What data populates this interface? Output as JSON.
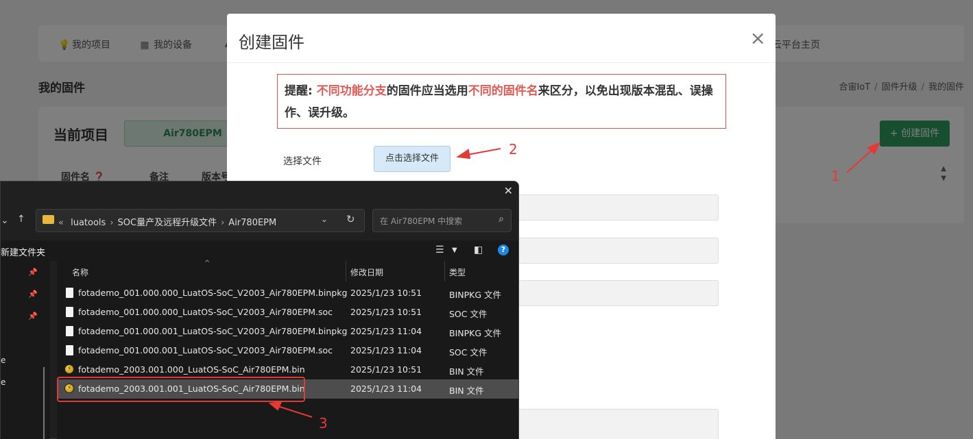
{
  "top_nav": {
    "items": [
      {
        "label": "我的项目",
        "icon": "lightbulb-icon"
      },
      {
        "label": "我的设备",
        "icon": "chip-icon"
      },
      {
        "label": "云平台主页",
        "icon": "home-icon"
      }
    ]
  },
  "page": {
    "title": "我的固件",
    "breadcrumb": [
      "合宙IoT",
      "固件升级",
      "我的固件"
    ]
  },
  "project_card": {
    "current_project_label": "当前项目",
    "project_name": "Air780EPM",
    "create_button": "+ 创建固件",
    "columns": [
      "固件名",
      "备注",
      "版本号"
    ]
  },
  "modal": {
    "title": "创建固件",
    "notice": {
      "prefix": "提醒:",
      "red1": "不同功能分支",
      "mid1": "的固件应当选用",
      "red2": "不同的固件名",
      "mid2": "来区分，以免出现版本混乱、误操作、误升级。"
    },
    "select_file_label": "选择文件",
    "select_file_button": "点击选择文件"
  },
  "file_dialog": {
    "path": [
      "luatools",
      "SOC量产及远程升级文件",
      "Air780EPM"
    ],
    "path_prefix": "«",
    "search_placeholder": "在 Air780EPM 中搜索",
    "new_folder": "新建文件夹",
    "columns": {
      "name": "名称",
      "date": "修改日期",
      "type": "类型"
    },
    "files": [
      {
        "name": "fotademo_001.000.000_LuatOS-SoC_V2003_Air780EPM.binpkg",
        "date": "2025/1/23 10:51",
        "type": "BINPKG 文件",
        "icon": "file-icon"
      },
      {
        "name": "fotademo_001.000.000_LuatOS-SoC_V2003_Air780EPM.soc",
        "date": "2025/1/23 10:51",
        "type": "SOC 文件",
        "icon": "file-icon"
      },
      {
        "name": "fotademo_001.000.001_LuatOS-SoC_V2003_Air780EPM.binpkg",
        "date": "2025/1/23 11:04",
        "type": "BINPKG 文件",
        "icon": "file-icon"
      },
      {
        "name": "fotademo_001.000.001_LuatOS-SoC_V2003_Air780EPM.soc",
        "date": "2025/1/23 11:04",
        "type": "SOC 文件",
        "icon": "file-icon"
      },
      {
        "name": "fotademo_2003.001.000_LuatOS-SoC_Air780EPM.bin",
        "date": "2025/1/23 10:51",
        "type": "BIN 文件",
        "icon": "bin-file-icon"
      },
      {
        "name": "fotademo_2003.001.001_LuatOS-SoC_Air780EPM.bin",
        "date": "2025/1/23 11:04",
        "type": "BIN 文件",
        "icon": "bin-file-icon",
        "selected": true
      }
    ],
    "side_labels": [
      "e",
      "e"
    ]
  },
  "annotations": {
    "step1": "1",
    "step2": "2",
    "step3": "3",
    "color": "#e53935"
  },
  "colors": {
    "primary_green": "#2c9c5e",
    "notice_red": "#e05a55",
    "select_blue": "#d6e9f8"
  }
}
